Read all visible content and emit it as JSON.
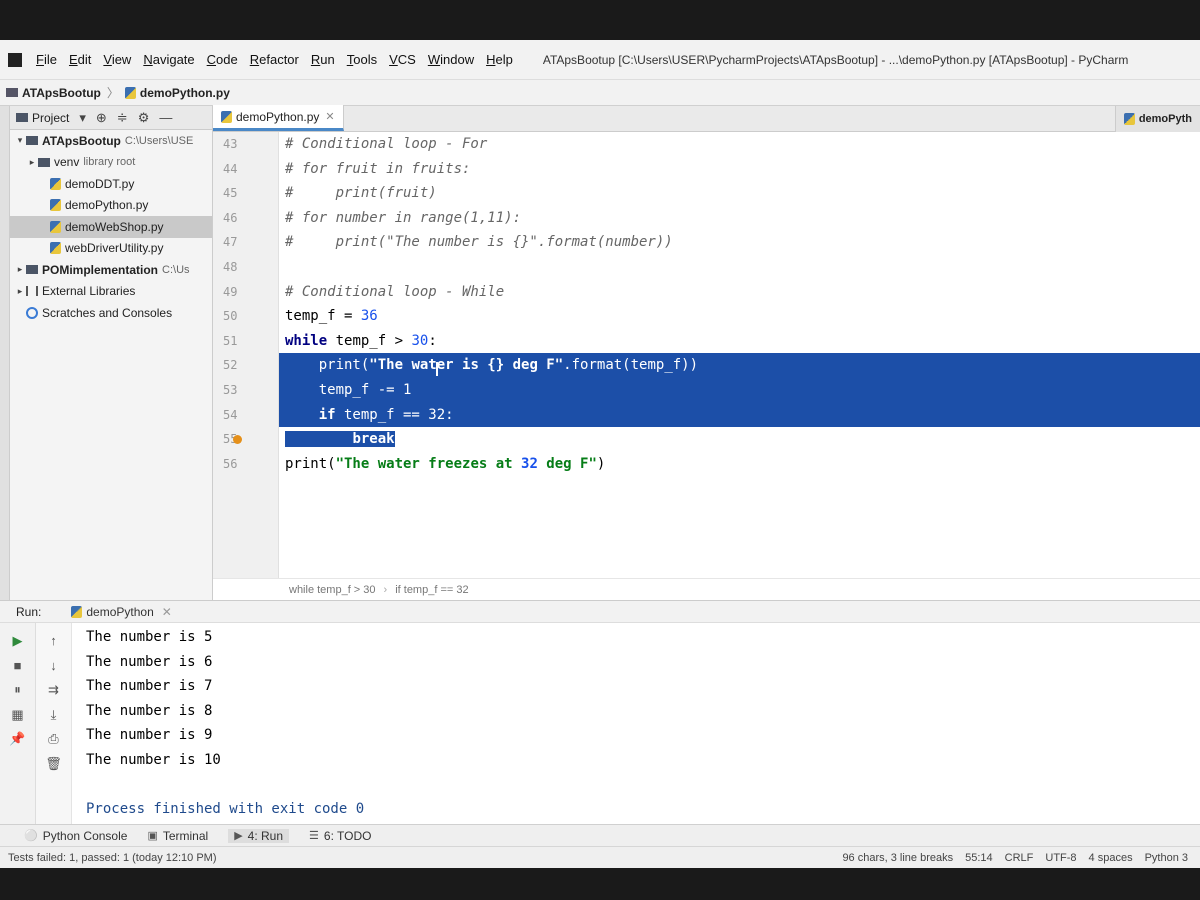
{
  "menu": {
    "items": [
      "File",
      "Edit",
      "View",
      "Navigate",
      "Code",
      "Refactor",
      "Run",
      "Tools",
      "VCS",
      "Window",
      "Help"
    ],
    "window_title": "ATApsBootup [C:\\Users\\USER\\PycharmProjects\\ATApsBootup] - ...\\demoPython.py [ATApsBootup] - PyCharm"
  },
  "navbar": {
    "project": "ATApsBootup",
    "file": "demoPython.py"
  },
  "project_panel": {
    "title": "Project",
    "tree": [
      {
        "label": "ATApsBootup",
        "hint": "C:\\Users\\USE",
        "kind": "folder",
        "bold": true,
        "arrow": "▾",
        "indent": 0
      },
      {
        "label": "venv",
        "hint": "library root",
        "kind": "folder",
        "bold": false,
        "arrow": "▸",
        "indent": 1
      },
      {
        "label": "demoDDT.py",
        "hint": "",
        "kind": "py",
        "bold": false,
        "arrow": "",
        "indent": 2
      },
      {
        "label": "demoPython.py",
        "hint": "",
        "kind": "py",
        "bold": false,
        "arrow": "",
        "indent": 2
      },
      {
        "label": "demoWebShop.py",
        "hint": "",
        "kind": "py",
        "bold": false,
        "arrow": "",
        "indent": 2,
        "selected": true
      },
      {
        "label": "webDriverUtility.py",
        "hint": "",
        "kind": "py",
        "bold": false,
        "arrow": "",
        "indent": 2
      },
      {
        "label": "POMimplementation",
        "hint": "C:\\Us",
        "kind": "folder",
        "bold": true,
        "arrow": "▸",
        "indent": 0
      },
      {
        "label": "External Libraries",
        "hint": "",
        "kind": "lib",
        "bold": false,
        "arrow": "▸",
        "indent": 0
      },
      {
        "label": "Scratches and Consoles",
        "hint": "",
        "kind": "scratch",
        "bold": false,
        "arrow": "",
        "indent": 0
      }
    ]
  },
  "editor": {
    "tab_label": "demoPython.py",
    "tab_right_label": "demoPyth",
    "line_numbers": [
      "43",
      "44",
      "45",
      "46",
      "47",
      "48",
      "49",
      "50",
      "51",
      "52",
      "53",
      "54",
      "55",
      "56"
    ],
    "code_lines": [
      "# Conditional loop - For",
      "# for fruit in fruits:",
      "#     print(fruit)",
      "# for number in range(1,11):",
      "#     print(\"The number is {}\".format(number))",
      "",
      "# Conditional loop - While",
      "temp_f = 36",
      "while temp_f > 30:",
      "    print(\"The water is {} deg F\".format(temp_f))",
      "    temp_f -= 1",
      "    if temp_f == 32:",
      "        break",
      "print(\"The water freezes at 32 deg F\")"
    ],
    "breadcrumb": [
      "while temp_f > 30",
      "if temp_f == 32"
    ]
  },
  "run": {
    "label": "Run:",
    "config_name": "demoPython",
    "output": [
      "The number is 5",
      "The number is 6",
      "The number is 7",
      "The number is 8",
      "The number is 9",
      "The number is 10",
      "",
      "Process finished with exit code 0"
    ]
  },
  "bottom_tabs": [
    "Python Console",
    "Terminal",
    "4: Run",
    "6: TODO"
  ],
  "status": {
    "left": "Tests failed: 1, passed: 1 (today 12:10 PM)",
    "chars": "96 chars, 3 line breaks",
    "position": "55:14",
    "line_sep": "CRLF",
    "encoding": "UTF-8",
    "indent": "4 spaces",
    "interpreter": "Python 3"
  }
}
